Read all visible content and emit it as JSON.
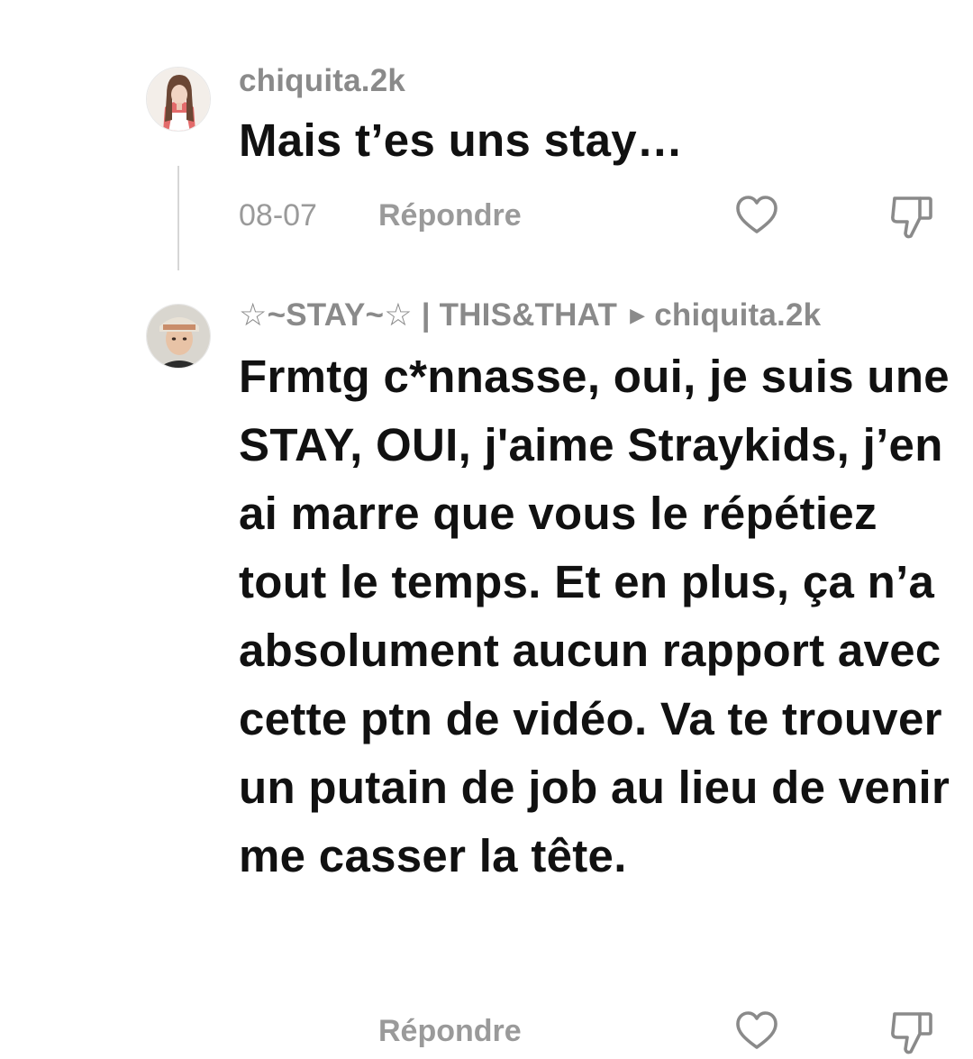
{
  "comments": [
    {
      "username": "chiquita.2k",
      "text": "Mais t’es uns stay…",
      "date": "08-07",
      "reply_label": "Répondre"
    },
    {
      "username": "☆~STAY~☆ | THIS&THAT",
      "reply_to": "chiquita.2k",
      "text": "Frmtg c*nnasse, oui, je suis une STAY, OUI, j'aime Straykids, j’en ai marre que vous le répétiez tout le temps. Et en plus, ça n’a absolument aucun rapport avec cette ptn de vidéo. Va te trouver un putain de job au lieu de venir me casser la tête.",
      "reply_label": "Répondre"
    }
  ],
  "icons": {
    "like": "heart-outline-icon",
    "dislike": "thumbs-down-outline-icon",
    "reply_caret": "caret-right-icon"
  },
  "colors": {
    "text": "#111111",
    "muted": "#8a8a8a",
    "thread_line": "#d6d6d6"
  }
}
